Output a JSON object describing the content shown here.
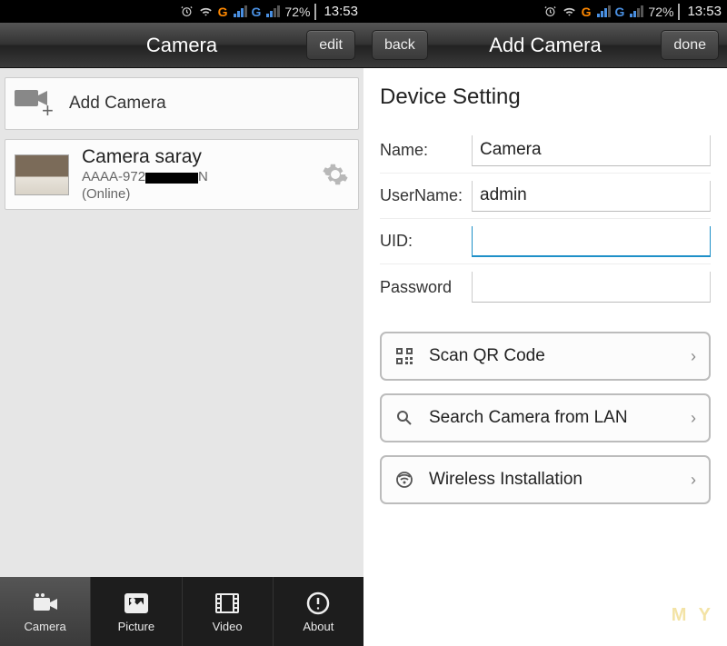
{
  "statusbar": {
    "carrier1": "G",
    "carrier2": "G",
    "battery_pct": "72%",
    "time": "13:53"
  },
  "left": {
    "title": "Camera",
    "edit_btn": "edit",
    "add_row": "Add Camera",
    "camera": {
      "name": "Camera saray",
      "uid_prefix": "AAAA-972",
      "uid_suffix": "N",
      "status": "(Online)"
    },
    "nav": {
      "camera": "Camera",
      "picture": "Picture",
      "video": "Video",
      "about": "About"
    }
  },
  "right": {
    "title": "Add Camera",
    "back_btn": "back",
    "done_btn": "done",
    "section": "Device Setting",
    "fields": {
      "name_label": "Name:",
      "name_value": "Camera",
      "user_label": "UserName:",
      "user_value": "admin",
      "uid_label": "UID:",
      "uid_value": "",
      "pass_label": "Password",
      "pass_value": ""
    },
    "actions": {
      "qr": "Scan QR Code",
      "lan": "Search Camera from LAN",
      "wireless": "Wireless Installation"
    }
  },
  "watermark": "M Y"
}
